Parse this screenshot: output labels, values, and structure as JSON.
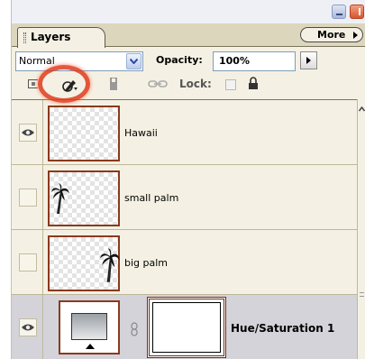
{
  "panel": {
    "tab_label": "Layers",
    "more_label": "More"
  },
  "controls": {
    "blend_mode": "Normal",
    "opacity_label": "Opacity:",
    "opacity_value": "100%",
    "lock_label": "Lock:"
  },
  "layers": [
    {
      "name": "Hawaii",
      "visible": true,
      "selected": false
    },
    {
      "name": "small palm",
      "visible": false,
      "selected": false
    },
    {
      "name": "big palm",
      "visible": false,
      "selected": false
    },
    {
      "name": "Hue/Saturation 1",
      "visible": true,
      "selected": true
    }
  ],
  "colors": {
    "panel_bg": "#f4f1e4",
    "selected_row": "#d4d3da",
    "thumbnail_border": "#8a3a1c",
    "highlight_ring": "#e03d1f"
  },
  "icons": [
    "minimize-icon",
    "close-icon",
    "tab-grip-icon",
    "more-arrow-icon",
    "dropdown-arrow-icon",
    "lock-transparency-icon",
    "lock-paint-icon",
    "lock-move-icon",
    "link-icon",
    "lock-all-icon",
    "eye-icon",
    "chain-icon",
    "scroll-up-icon"
  ]
}
